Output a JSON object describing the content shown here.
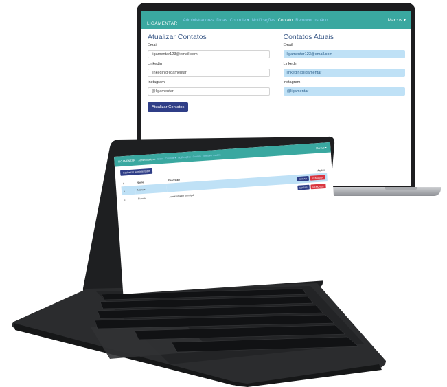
{
  "back_app": {
    "brand": "LIGAMENTAR",
    "nav_links": [
      "Administradores",
      "Dicas",
      "Controle ▾",
      "Notificações",
      "Contato",
      "Remover usuário"
    ],
    "active_link": "Contato",
    "user": "Marcus ▾",
    "form": {
      "title": "Atualizar Contatos",
      "email_label": "Email",
      "email_value": "ligamentar123@email.com",
      "linkedin_label": "Linkedin",
      "linkedin_value": "linkedin@ligamentar",
      "instagram_label": "Instagram",
      "instagram_value": "@ligamentar",
      "submit_label": "Atualizar Contatos"
    },
    "current": {
      "title": "Contatos Atuais",
      "email_label": "Email",
      "email_value": "ligamentar123@email.com",
      "linkedin_label": "Linkedin",
      "linkedin_value": "linkedin@ligamentar",
      "instagram_label": "Instagram",
      "instagram_value": "@ligamentar"
    }
  },
  "front_app": {
    "brand": "LIGAMENTAR",
    "nav_links": [
      "Administradores",
      "Dicas",
      "Controle ▾",
      "Notificações",
      "Contato",
      "Remover usuário"
    ],
    "active_link": "Administradores",
    "user": "Marcus ▾",
    "add_button": "Cadastrar Administrador",
    "table": {
      "headers": [
        "#",
        "Nome",
        "Descrição",
        "Ações"
      ],
      "rows": [
        {
          "id": "1",
          "name": "Marcus",
          "desc": "",
          "edit": "EDITAR",
          "delete": "REMOVER"
        },
        {
          "id": "2",
          "name": "Bianca",
          "desc": "Administrador principal",
          "edit": "EDITAR",
          "delete": "REMOVER"
        }
      ]
    }
  },
  "colors": {
    "navbar": "#3aa8a0",
    "primary_button": "#2f3e87",
    "danger_button": "#d9353f",
    "readonly_field": "#bfe1f6",
    "heading": "#3c5a88"
  }
}
